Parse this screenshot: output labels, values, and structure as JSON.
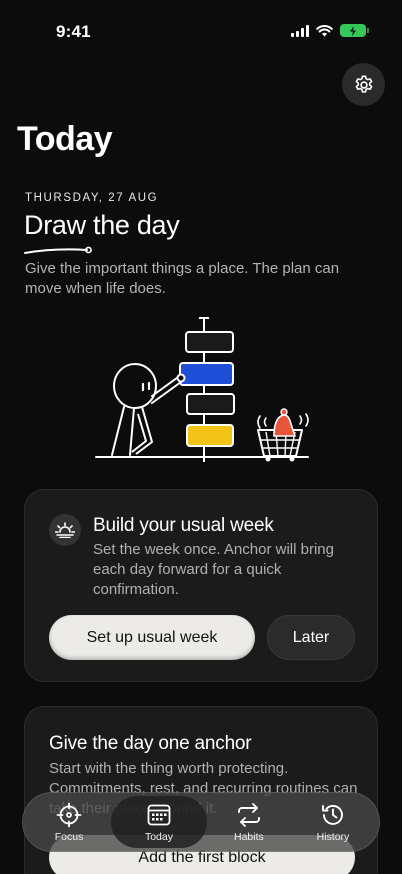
{
  "status_bar": {
    "time": "9:41"
  },
  "header": {
    "title": "Today",
    "settings_icon": "gear-icon"
  },
  "hero": {
    "date": "THURSDAY, 27 AUG",
    "title": "Draw the day",
    "subtitle": "Give the important things a place. The plan can move when life does."
  },
  "usual_week_card": {
    "icon": "sunrise-icon",
    "title": "Build your usual week",
    "body": "Set the week once. Anchor will bring each day forward for a quick confirmation.",
    "primary_label": "Set up usual week",
    "secondary_label": "Later"
  },
  "anchor_card": {
    "title": "Give the day one anchor",
    "body": "Start with the thing worth protecting. Commitments, rest, and recurring routines can take their place around it.",
    "button_label": "Add the first block"
  },
  "tabs": [
    {
      "label": "Focus",
      "icon": "crosshair-icon",
      "active": false
    },
    {
      "label": "Today",
      "icon": "calendar-icon",
      "active": true
    },
    {
      "label": "Habits",
      "icon": "repeat-icon",
      "active": false
    },
    {
      "label": "History",
      "icon": "history-icon",
      "active": false
    }
  ],
  "colors": {
    "background": "#0c0c0c",
    "card": "#1b1b1b",
    "accent_blue": "#1f4fd8",
    "accent_yellow": "#f2c418",
    "accent_red": "#e8553a",
    "battery": "#34c759"
  }
}
